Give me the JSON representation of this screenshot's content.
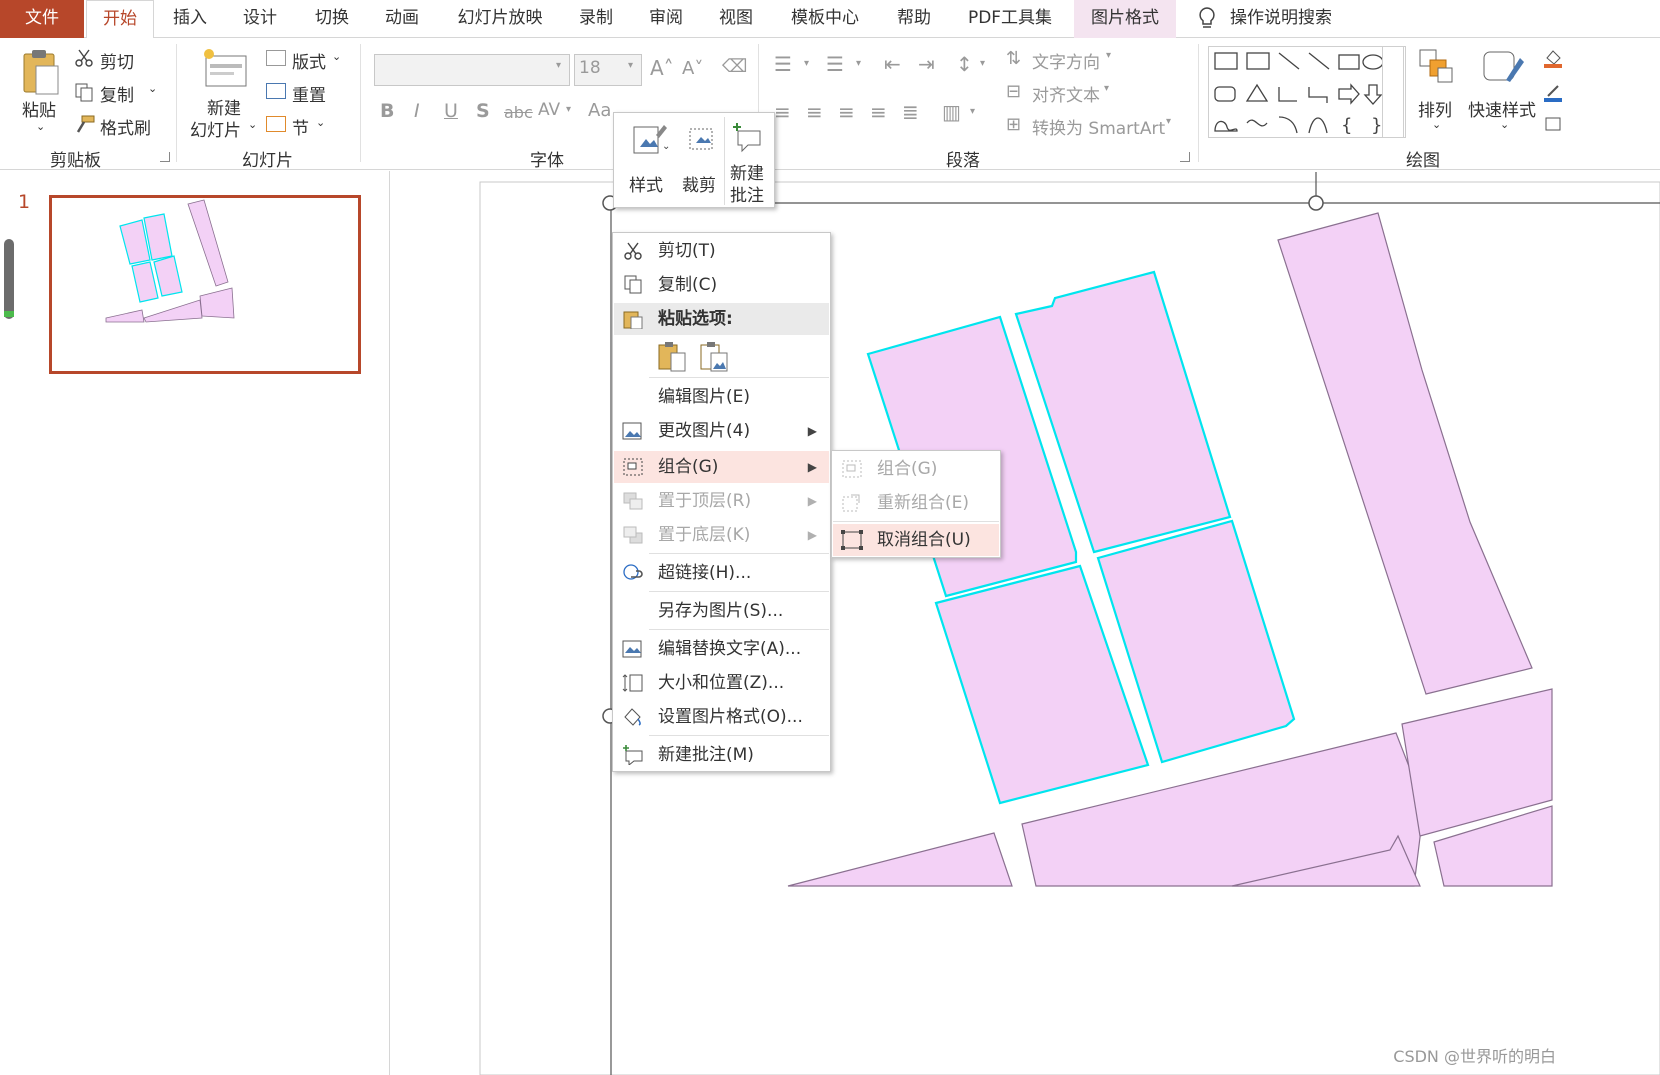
{
  "tabs": [
    "文件",
    "开始",
    "插入",
    "设计",
    "切换",
    "动画",
    "幻灯片放映",
    "录制",
    "审阅",
    "视图",
    "模板中心",
    "帮助",
    "PDF工具集",
    "图片格式"
  ],
  "tell_me": "操作说明搜索",
  "ribbon": {
    "clipboard": {
      "paste": "粘贴",
      "cut": "剪切",
      "copy": "复制",
      "painter": "格式刷",
      "group": "剪贴板"
    },
    "slides": {
      "new_slide_1": "新建",
      "new_slide_2": "幻灯片",
      "layout": "版式",
      "reset": "重置",
      "section": "节",
      "group": "幻灯片"
    },
    "font": {
      "size": "18",
      "bold": "B",
      "italic": "I",
      "underline": "U",
      "shadow": "S",
      "strike": "abc",
      "spacing": "AV",
      "case": "Aa",
      "group": "字体"
    },
    "paragraph": {
      "text_dir": "文字方向",
      "align_text": "对齐文本",
      "smartart": "转换为 SmartArt",
      "group": "段落"
    },
    "drawing": {
      "arrange": "排列",
      "quick_styles": "快速样式",
      "group": "绘图"
    }
  },
  "mini_toolbar": {
    "style": "样式",
    "crop": "裁剪",
    "new_comment_1": "新建",
    "new_comment_2": "批注"
  },
  "slide_number": "1",
  "context_menu": {
    "cut": "剪切(T)",
    "copy": "复制(C)",
    "paste_options": "粘贴选项:",
    "edit_picture": "编辑图片(E)",
    "change_picture": "更改图片(4)",
    "group": "组合(G)",
    "bring_front": "置于顶层(R)",
    "send_back": "置于底层(K)",
    "hyperlink": "超链接(H)...",
    "save_as_picture": "另存为图片(S)...",
    "edit_alt_text": "编辑替换文字(A)...",
    "size_position": "大小和位置(Z)...",
    "format_picture": "设置图片格式(O)...",
    "new_comment": "新建批注(M)"
  },
  "submenu": {
    "group": "组合(G)",
    "regroup": "重新组合(E)",
    "ungroup": "取消组合(U)"
  },
  "watermark": "CSDN @世界听的明白",
  "colors": {
    "accent": "#b7472a",
    "selection": "#00e5ee",
    "parcel_fill": "#f3d1f6",
    "menu_highlight": "#fce4e0"
  }
}
